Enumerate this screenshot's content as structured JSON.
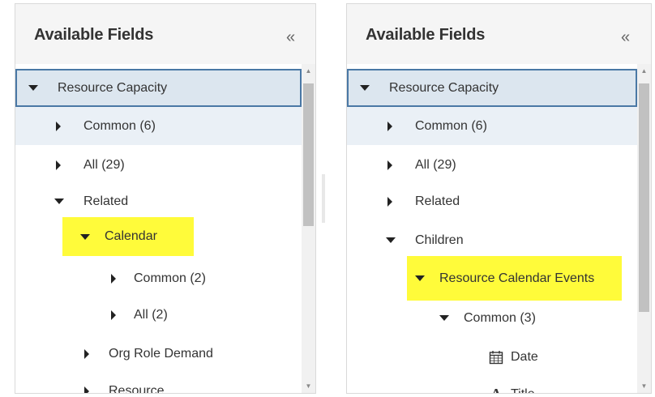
{
  "left_panel": {
    "title": "Available Fields",
    "collapse_glyph": "«",
    "items": {
      "root": "Resource Capacity",
      "common": "Common (6)",
      "all": "All (29)",
      "related": "Related",
      "calendar": "Calendar",
      "cal_common": "Common (2)",
      "cal_all": "All (2)",
      "org_role": "Org Role Demand",
      "resource": "Resource"
    }
  },
  "right_panel": {
    "title": "Available Fields",
    "collapse_glyph": "«",
    "items": {
      "root": "Resource Capacity",
      "common": "Common (6)",
      "all": "All (29)",
      "related": "Related",
      "children": "Children",
      "events": "Resource Calendar Events",
      "events_common": "Common (3)",
      "date": "Date",
      "title": "Title"
    }
  },
  "icons": {
    "collapse": "double-chevron-left-icon",
    "expanded": "caret-down-icon",
    "collapsed": "caret-right-icon",
    "date_field": "calendar-icon",
    "text_field": "text-type-icon"
  },
  "colors": {
    "highlight": "#fffb3a",
    "root_border": "#4a78a5",
    "root_bg": "#dce6ef",
    "selected_bg": "#eaf0f6"
  }
}
